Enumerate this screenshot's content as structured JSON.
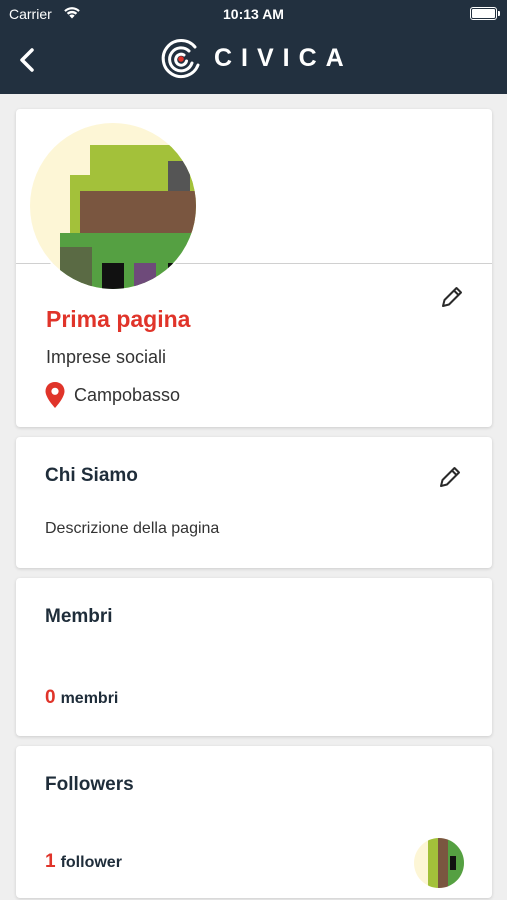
{
  "status_bar": {
    "carrier": "Carrier",
    "time": "10:13 AM"
  },
  "header": {
    "brand": "CIVICA",
    "back_icon": "chevron-left-icon",
    "logo_icon": "civica-logo-icon"
  },
  "profile": {
    "name": "Prima pagina",
    "category": "Imprese sociali",
    "location": "Campobasso",
    "edit_icon": "pencil-icon"
  },
  "about": {
    "title": "Chi Siamo",
    "description": "Descrizione della pagina",
    "edit_icon": "pencil-icon"
  },
  "members": {
    "title": "Membri",
    "count": "0",
    "label": "membri"
  },
  "followers": {
    "title": "Followers",
    "count": "1",
    "label": "follower"
  },
  "colors": {
    "header_bg": "#22303f",
    "accent_red": "#e0342a",
    "text_dark": "#1f2d3a",
    "background": "#efefef"
  }
}
